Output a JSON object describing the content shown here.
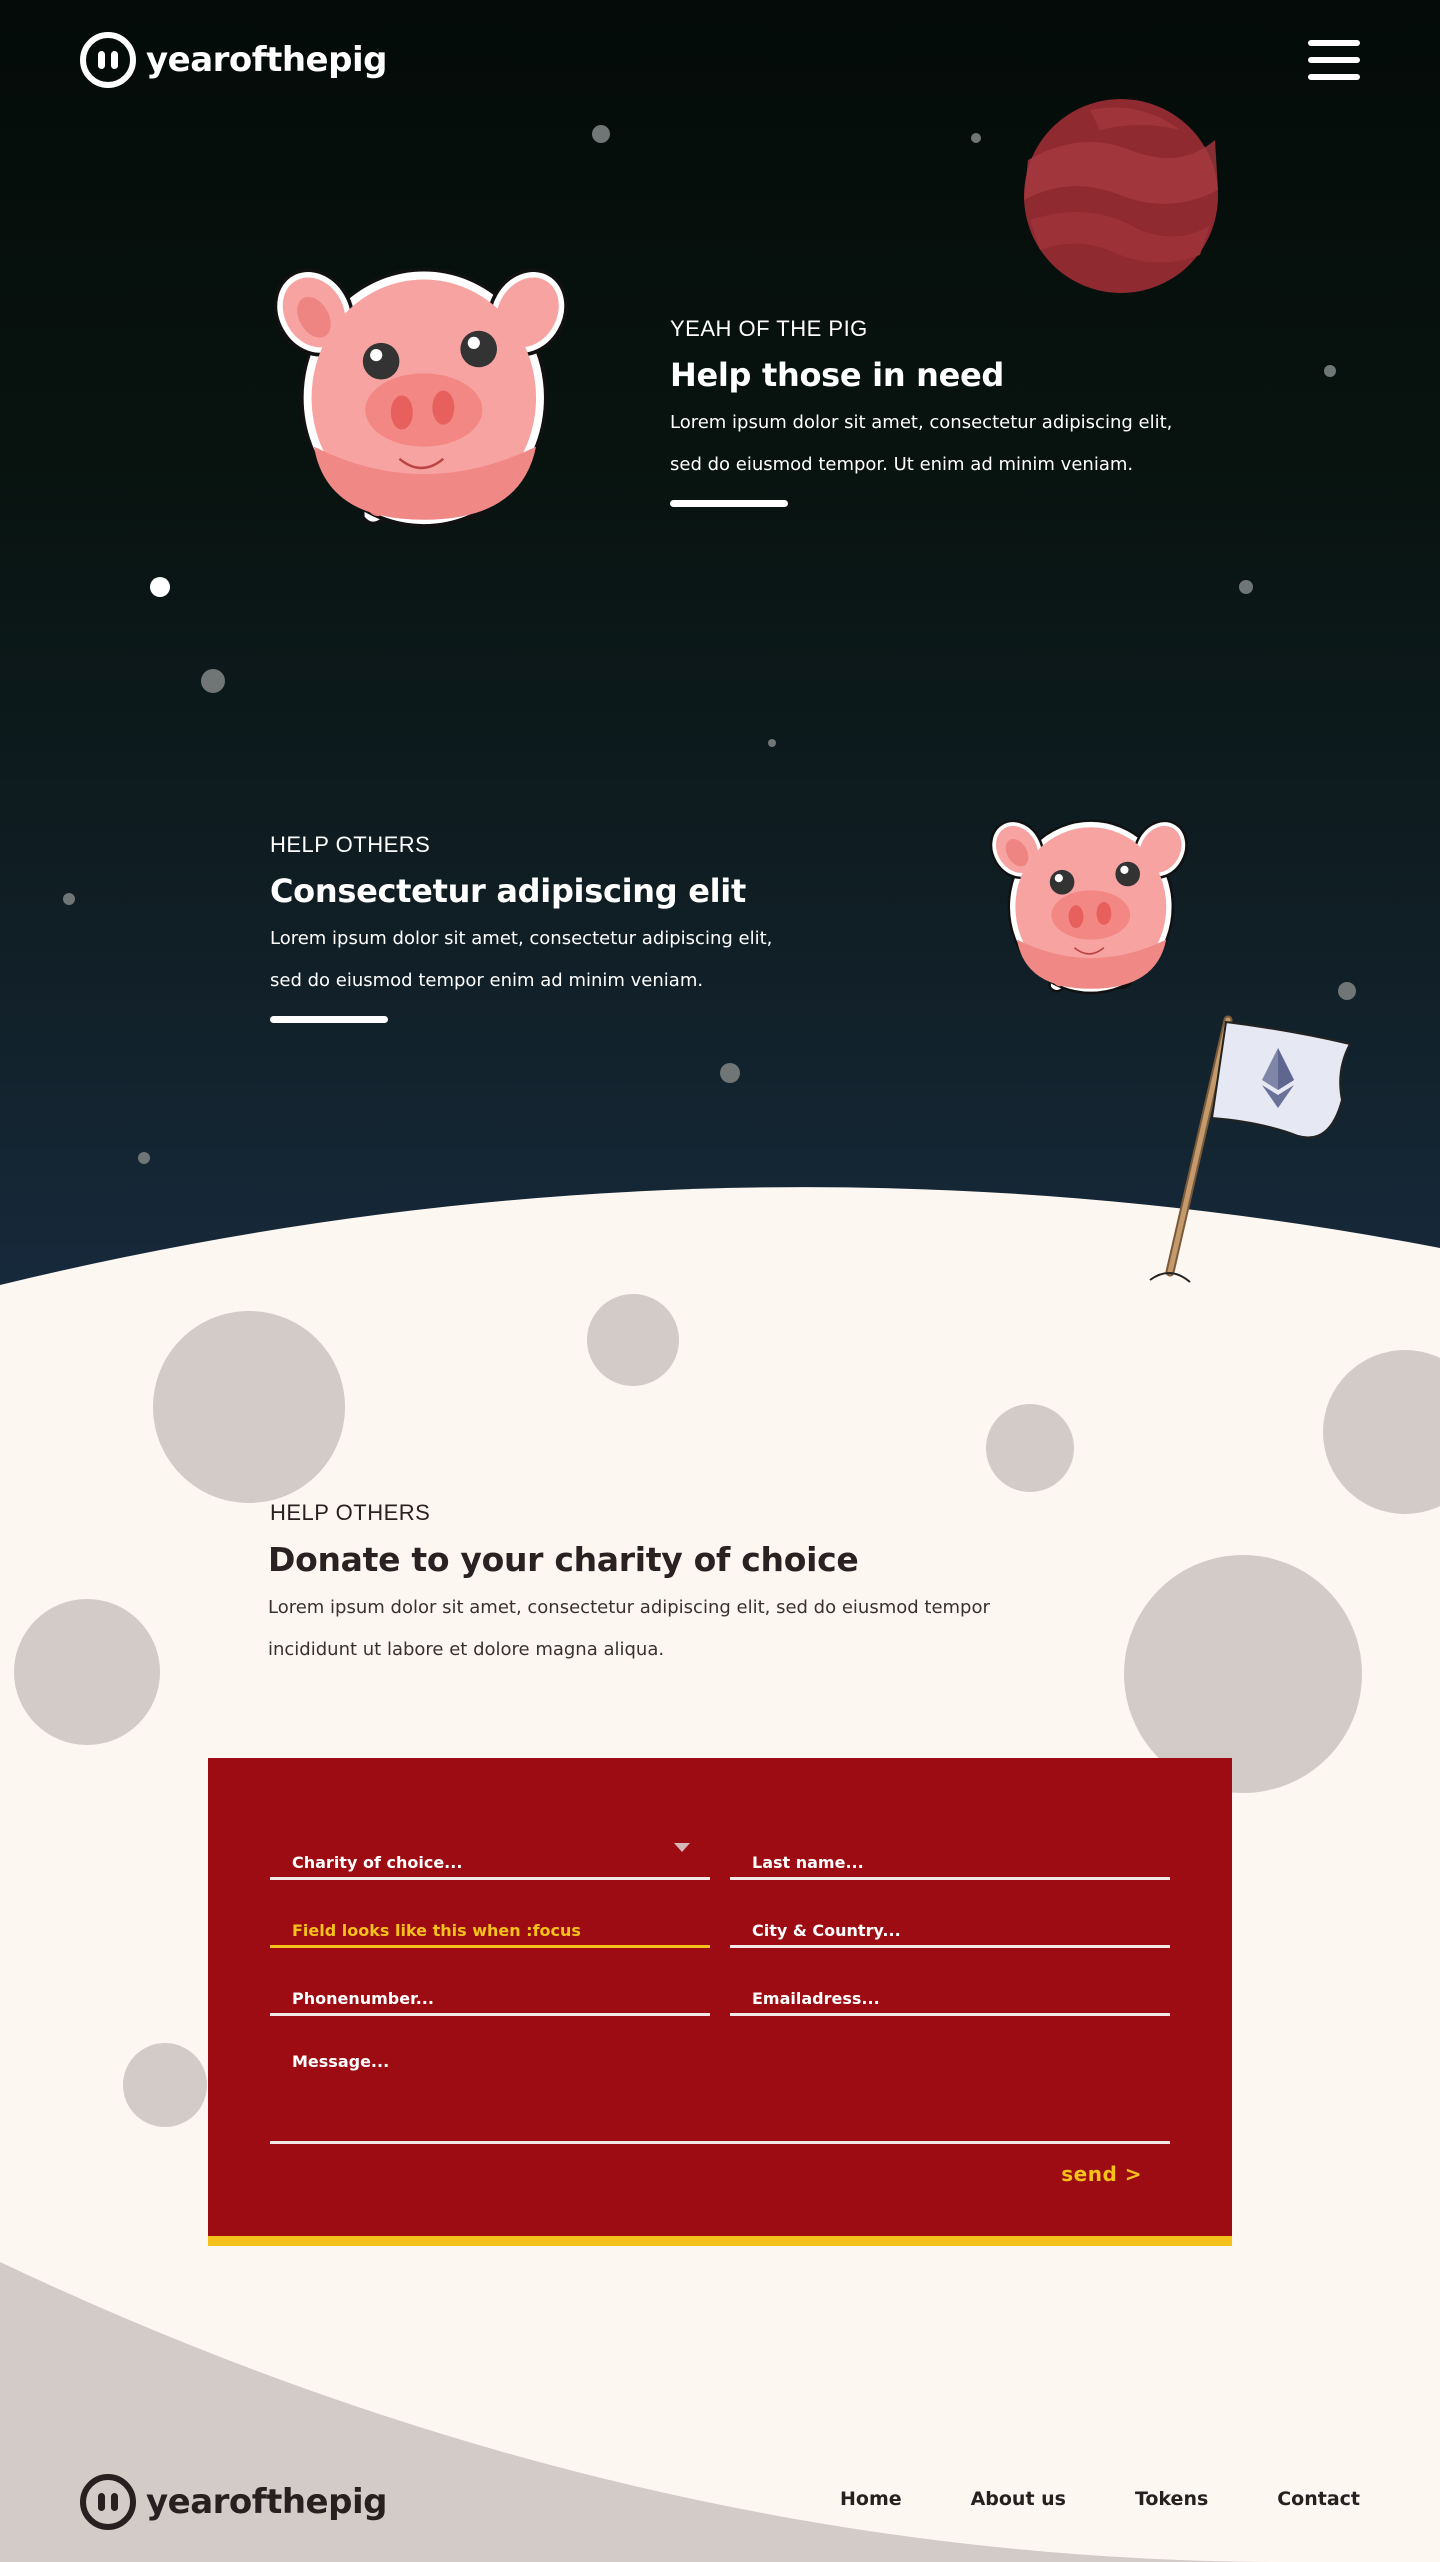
{
  "brand": {
    "name": "yearofthepig"
  },
  "header": {
    "menu_icon": "hamburger-menu-icon"
  },
  "section_1": {
    "eyebrow": "YEAH OF THE PIG",
    "title": "Help those in need",
    "body_line_1": "Lorem ipsum dolor sit amet, consectetur adipiscing elit,",
    "body_line_2": "sed do eiusmod tempor. Ut enim ad minim veniam."
  },
  "section_2": {
    "eyebrow": "HELP OTHERS",
    "title": "Consectetur adipiscing elit",
    "body_line_1": "Lorem ipsum dolor sit amet, consectetur adipiscing elit,",
    "body_line_2": "sed do eiusmod tempor enim ad minim veniam."
  },
  "section_3": {
    "eyebrow": "HELP OTHERS",
    "title": "Donate to your charity of choice",
    "body_line_1": "Lorem ipsum dolor sit amet, consectetur adipiscing elit, sed do eiusmod tempor",
    "body_line_2": "incididunt ut labore et dolore magna aliqua."
  },
  "form": {
    "charity_placeholder": "Charity of choice...",
    "last_name_placeholder": "Last name...",
    "focus_example_placeholder": "Field looks like this when :focus",
    "city_country_placeholder": "City & Country...",
    "phone_placeholder": "Phonenumber...",
    "email_placeholder": "Emailadress...",
    "message_placeholder": "Message...",
    "send_label": "send  >"
  },
  "footer": {
    "nav": [
      "Home",
      "About us",
      "Tokens",
      "Contact"
    ]
  },
  "colors": {
    "space_top": "#040b09",
    "space_bottom": "#172a3c",
    "moon": "#fdf7f1",
    "crater": "#d2cbc8",
    "form_red": "#9c0c12",
    "accent_yellow": "#f4c21a",
    "planet": "#8e2a30",
    "pig_pink": "#f7a3a1"
  }
}
